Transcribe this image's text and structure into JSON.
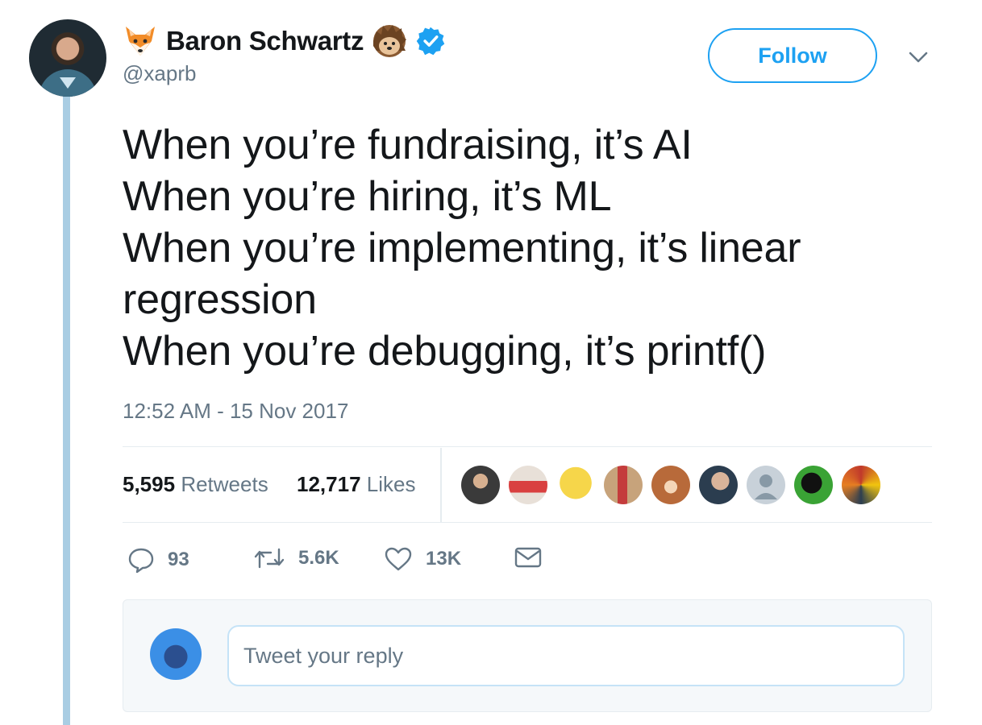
{
  "author": {
    "display_name": "Baron Schwartz",
    "handle": "@xaprb",
    "verified": true
  },
  "icons": {
    "name_prefix": "fox-face-icon",
    "name_suffix": "hedgehog-icon",
    "verified": "verified-badge-icon",
    "more": "chevron-down-icon",
    "reply": "reply-icon",
    "retweet": "retweet-icon",
    "like": "heart-icon",
    "dm": "envelope-icon"
  },
  "follow_label": "Follow",
  "tweet": {
    "lines": [
      "When you’re fundraising, it’s AI",
      "When you’re hiring, it’s ML",
      "When you’re implementing, it’s linear",
      "regression",
      "When you’re debugging, it’s printf()"
    ],
    "timestamp": "12:52 AM - 15 Nov 2017"
  },
  "stats": {
    "retweets_count": "5,595",
    "retweets_label": "Retweets",
    "likes_count": "12,717",
    "likes_label": "Likes"
  },
  "likers_count": 9,
  "actions": {
    "replies": "93",
    "retweets": "5.6K",
    "likes": "13K"
  },
  "reply": {
    "placeholder": "Tweet your reply"
  },
  "colors": {
    "accent": "#1da1f2",
    "thread_line": "#a9cde3",
    "muted_text": "#657786",
    "verified": "#1da1f2"
  }
}
